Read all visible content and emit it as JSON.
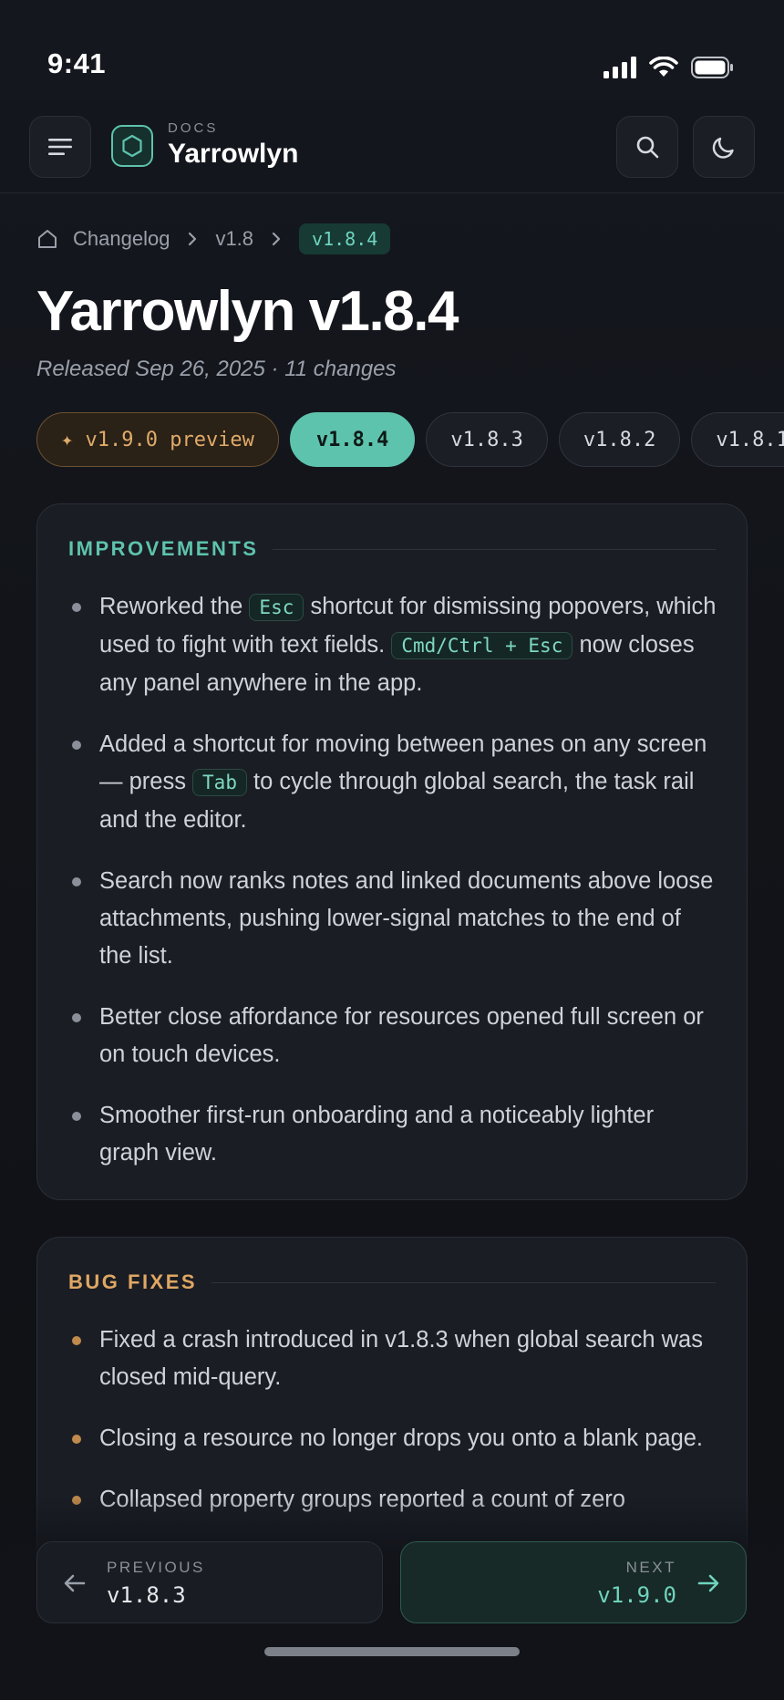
{
  "status_bar": {
    "time": "9:41"
  },
  "header": {
    "kicker": "DOCS",
    "title": "Yarrowlyn"
  },
  "breadcrumb": {
    "items": [
      "Changelog",
      "v1.8"
    ],
    "current": "v1.8.4"
  },
  "page": {
    "title": "Yarrowlyn v1.8.4",
    "meta": "Released Sep 26, 2025 · 11 changes"
  },
  "chips": [
    {
      "label": "✦ v1.9.0 preview",
      "kind": "preview"
    },
    {
      "label": "v1.8.4",
      "kind": "active"
    },
    {
      "label": "v1.8.3",
      "kind": "normal"
    },
    {
      "label": "v1.8.2",
      "kind": "normal"
    },
    {
      "label": "v1.8.1",
      "kind": "normal"
    }
  ],
  "improvements": {
    "heading": "IMPROVEMENTS",
    "items": [
      {
        "t1": "Reworked the ",
        "k1": "Esc",
        "t2": " shortcut for dismissing popovers, which used to fight with text fields. ",
        "k2": "Cmd/Ctrl + Esc",
        "t3": " now closes any panel anywhere in the app."
      },
      {
        "t1": "Added a shortcut for moving between panes on any screen — press ",
        "k1": "Tab",
        "t2": " to cycle through global search, the task rail and the editor."
      },
      {
        "t1": "Search now ranks notes and linked documents above loose attachments, pushing lower-signal matches to the end of the list."
      },
      {
        "t1": "Better close affordance for resources opened full screen or on touch devices."
      },
      {
        "t1": "Smoother first-run onboarding and a noticeably lighter graph view."
      }
    ]
  },
  "bug_fixes": {
    "heading": "BUG FIXES",
    "items": [
      "Fixed a crash introduced in v1.8.3 when global search was closed mid-query.",
      "Closing a resource no longer drops you onto a blank page.",
      "Collapsed property groups reported a count of zero"
    ]
  },
  "pager": {
    "prev_kicker": "PREVIOUS",
    "prev_version": "v1.8.3",
    "next_kicker": "NEXT",
    "next_version": "v1.9.0"
  },
  "colors": {
    "accent": "#5ec3ad",
    "amber": "#e0a763",
    "background": "#111319"
  }
}
